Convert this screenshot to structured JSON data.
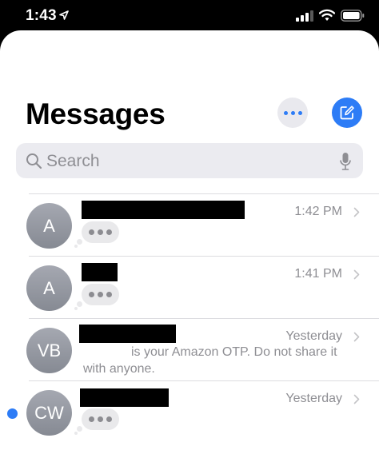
{
  "status": {
    "time": "1:43"
  },
  "header": {
    "title": "Messages"
  },
  "search": {
    "placeholder": "Search"
  },
  "conversations": [
    {
      "initials": "A",
      "time": "1:42 PM",
      "preview_type": "typing",
      "unread": false,
      "preview_line1": "",
      "preview_line2": ""
    },
    {
      "initials": "A",
      "time": "1:41 PM",
      "preview_type": "typing",
      "unread": false,
      "preview_line1": "",
      "preview_line2": ""
    },
    {
      "initials": "VB",
      "time": "Yesterday",
      "preview_type": "text",
      "unread": false,
      "preview_line1": "is your Amazon OTP. Do not share it",
      "preview_line2": "with anyone."
    },
    {
      "initials": "CW",
      "time": "Yesterday",
      "preview_type": "typing",
      "unread": true,
      "preview_line1": "",
      "preview_line2": ""
    }
  ],
  "colors": {
    "accent": "#2d7cf6",
    "secondary_text": "#8e8e93"
  }
}
